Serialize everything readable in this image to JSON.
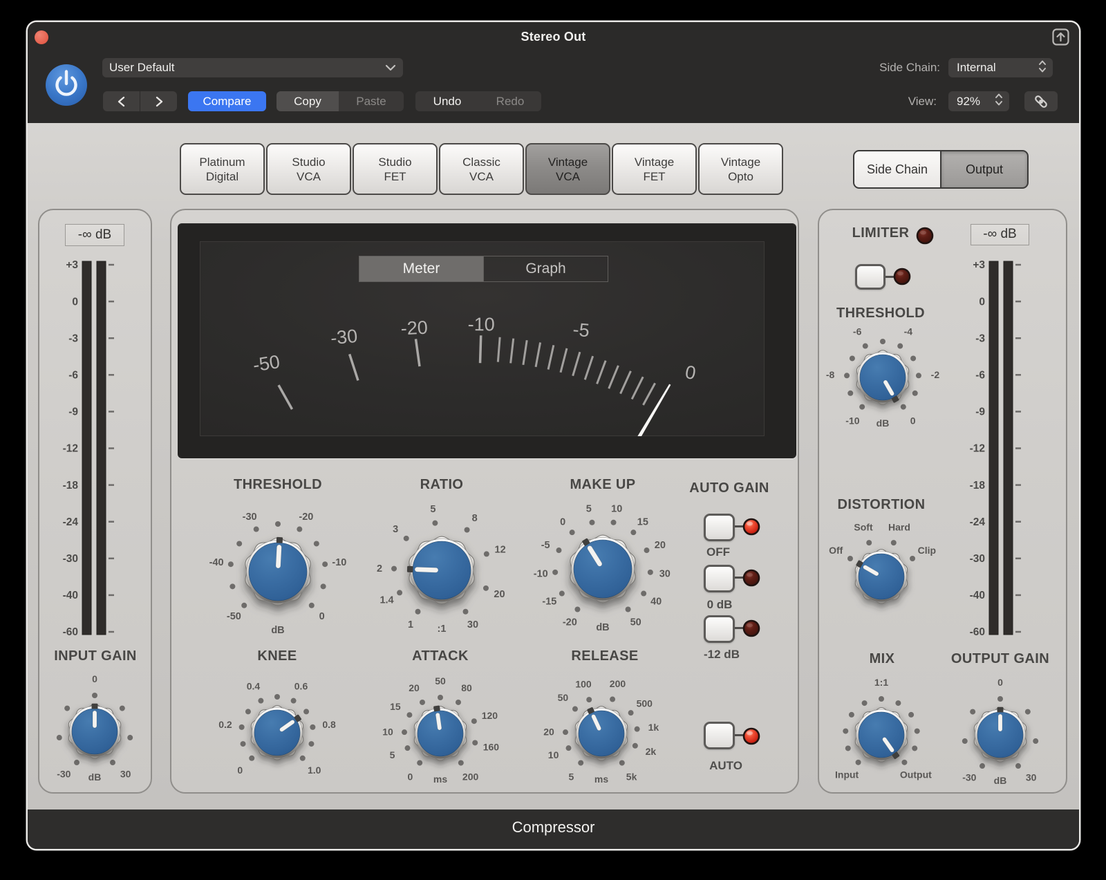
{
  "titlebar": {
    "title": "Stereo Out",
    "preset": {
      "value": "User Default"
    },
    "compare_label": "Compare",
    "copy_label": "Copy",
    "paste_label": "Paste",
    "undo_label": "Undo",
    "redo_label": "Redo",
    "side_chain_label": "Side Chain:",
    "side_chain_value": "Internal",
    "view_label": "View:",
    "view_value": "92%"
  },
  "footer": {
    "title": "Compressor"
  },
  "tabs": {
    "selected": "Vintage VCA",
    "items": [
      {
        "lines": [
          "Platinum",
          "Digital"
        ],
        "selected": false
      },
      {
        "lines": [
          "Studio",
          "VCA"
        ],
        "selected": false
      },
      {
        "lines": [
          "Studio",
          "FET"
        ],
        "selected": false
      },
      {
        "lines": [
          "Classic",
          "VCA"
        ],
        "selected": false
      },
      {
        "lines": [
          "Vintage",
          "VCA"
        ],
        "selected": true
      },
      {
        "lines": [
          "Vintage",
          "FET"
        ],
        "selected": false
      },
      {
        "lines": [
          "Vintage",
          "Opto"
        ],
        "selected": false
      }
    ]
  },
  "view_toggle": {
    "items": [
      {
        "label": "Side Chain",
        "selected": false
      },
      {
        "label": "Output",
        "selected": true
      }
    ]
  },
  "vu": {
    "buttons": [
      {
        "label": "Meter",
        "selected": true
      },
      {
        "label": "Graph",
        "selected": false
      }
    ],
    "pivot": [
      390,
      700
    ],
    "major_ticks": [
      -29.3,
      -17.9,
      -7.9,
      1.7
    ],
    "minor_ticks": {
      "from": 4.5,
      "step": 2,
      "count": 13
    },
    "labels": [
      {
        "text": "-50",
        "angle": -29.3,
        "r": 600
      },
      {
        "text": "-30",
        "angle": -17.9,
        "r": 590
      },
      {
        "text": "-20",
        "angle": -7.9,
        "r": 580
      },
      {
        "text": "-10",
        "angle": 1.7,
        "r": 580
      },
      {
        "text": "-5",
        "angle": 15.8,
        "r": 594
      },
      {
        "text": "0",
        "angle": 32.1,
        "r": 602
      }
    ],
    "needle_angle": 30.5
  },
  "input_meter": {
    "readout": "-∞ dB",
    "scale": [
      "+3",
      "0",
      "-3",
      "-6",
      "-9",
      "-12",
      "-18",
      "-24",
      "-30",
      "-40",
      "-60"
    ]
  },
  "output_meter": {
    "readout": "-∞ dB",
    "scale": [
      "+3",
      "0",
      "-3",
      "-6",
      "-9",
      "-12",
      "-18",
      "-24",
      "-30",
      "-40",
      "-60"
    ]
  },
  "auto_gain": {
    "title": "AUTO GAIN",
    "buttons": [
      {
        "label": "OFF",
        "led": true
      },
      {
        "label": "0 dB",
        "led": false
      },
      {
        "label": "-12 dB",
        "led": false
      }
    ]
  },
  "auto": {
    "label": "AUTO",
    "led": true
  },
  "limiter": {
    "title": "LIMITER",
    "led": false,
    "button_led": false
  },
  "knobs": {
    "threshold": {
      "title": "THRESHOLD",
      "size": "big",
      "pointer": 3,
      "sub": "dB",
      "labels": [
        {
          "t": "-50",
          "a": -135
        },
        {
          "t": "-40",
          "a": -81
        },
        {
          "t": "-30",
          "a": -27
        },
        {
          "t": "-20",
          "a": 27
        },
        {
          "t": "-10",
          "a": 81
        },
        {
          "t": "0",
          "a": 135
        }
      ],
      "dots": [
        -135,
        -108,
        -81,
        -54,
        -27,
        0,
        27,
        54,
        81,
        108,
        135
      ]
    },
    "ratio": {
      "title": "RATIO",
      "size": "big",
      "pointer": -88,
      "sub": ":1",
      "labels": [
        {
          "t": "1",
          "a": -150
        },
        {
          "t": "1.4",
          "a": -118
        },
        {
          "t": "2",
          "a": -88
        },
        {
          "t": "3",
          "a": -48
        },
        {
          "t": "5",
          "a": -8
        },
        {
          "t": "8",
          "a": 32
        },
        {
          "t": "12",
          "a": 70
        },
        {
          "t": "20",
          "a": 112
        },
        {
          "t": "30",
          "a": 150
        }
      ],
      "dots": [
        -150,
        -118,
        -88,
        -48,
        -8,
        32,
        70,
        112,
        150
      ]
    },
    "makeup": {
      "title": "MAKE UP",
      "size": "big",
      "pointer": -32,
      "sub": "dB",
      "labels": [
        {
          "t": "-20",
          "a": -148
        },
        {
          "t": "-15",
          "a": -121
        },
        {
          "t": "-10",
          "a": -94
        },
        {
          "t": "-5",
          "a": -67
        },
        {
          "t": "0",
          "a": -40
        },
        {
          "t": "5",
          "a": -13
        },
        {
          "t": "10",
          "a": 13
        },
        {
          "t": "15",
          "a": 40
        },
        {
          "t": "20",
          "a": 67
        },
        {
          "t": "30",
          "a": 94
        },
        {
          "t": "40",
          "a": 121
        },
        {
          "t": "50",
          "a": 148
        }
      ],
      "dots": [
        -148,
        -121,
        -94,
        -67,
        -40,
        -13,
        13,
        40,
        67,
        94,
        121,
        148
      ]
    },
    "knee": {
      "title": "KNEE",
      "size": "small",
      "pointer": 55,
      "sub": "",
      "labels": [
        {
          "t": "0",
          "a": -135
        },
        {
          "t": "0.2",
          "a": -81
        },
        {
          "t": "0.4",
          "a": -27
        },
        {
          "t": "0.6",
          "a": 27
        },
        {
          "t": "0.8",
          "a": 81
        },
        {
          "t": "1.0",
          "a": 135
        }
      ],
      "dots": [
        -135,
        -108,
        -81,
        -54,
        -27,
        0,
        27,
        54,
        81,
        108,
        135
      ]
    },
    "attack": {
      "title": "ATTACK",
      "size": "small",
      "pointer": -8,
      "sub": "ms",
      "labels": [
        {
          "t": "0",
          "a": -145
        },
        {
          "t": "5",
          "a": -114
        },
        {
          "t": "10",
          "a": -88
        },
        {
          "t": "15",
          "a": -59
        },
        {
          "t": "20",
          "a": -30
        },
        {
          "t": "50",
          "a": 0
        },
        {
          "t": "80",
          "a": 30
        },
        {
          "t": "120",
          "a": 70
        },
        {
          "t": "160",
          "a": 105
        },
        {
          "t": "200",
          "a": 145
        }
      ],
      "dots": [
        -145,
        -114,
        -88,
        -59,
        -30,
        0,
        30,
        70,
        105,
        145
      ]
    },
    "release": {
      "title": "RELEASE",
      "size": "small",
      "pointer": -25,
      "sub": "ms",
      "labels": [
        {
          "t": "100",
          "a": -20
        },
        {
          "t": "50",
          "a": -47
        },
        {
          "t": "20",
          "a": -88
        },
        {
          "t": "10",
          "a": -114
        },
        {
          "t": "5",
          "a": -145
        },
        {
          "t": "200",
          "a": 18
        },
        {
          "t": "500",
          "a": 55
        },
        {
          "t": "1k",
          "a": 83
        },
        {
          "t": "2k",
          "a": 110
        },
        {
          "t": "5k",
          "a": 145
        }
      ],
      "dots": [
        -145,
        -114,
        -88,
        -47,
        -20,
        18,
        55,
        83,
        110,
        145
      ]
    },
    "input_gain": {
      "title": "INPUT GAIN",
      "size": "small",
      "pointer": 0,
      "sub": "dB",
      "labels": [
        {
          "t": "0",
          "a": 0
        },
        {
          "t": "-30",
          "a": -144
        },
        {
          "t": "30",
          "a": 144
        }
      ],
      "dots": [
        -150,
        -100,
        -50,
        0,
        50,
        100,
        150
      ]
    },
    "limiter_threshold": {
      "title": "THRESHOLD",
      "size": "small",
      "pointer": 150,
      "sub": "dB",
      "labels": [
        {
          "t": "-10",
          "a": -145
        },
        {
          "t": "-8",
          "a": -87
        },
        {
          "t": "-6",
          "a": -29
        },
        {
          "t": "-4",
          "a": 29
        },
        {
          "t": "-2",
          "a": 87
        },
        {
          "t": "0",
          "a": 145
        }
      ],
      "dots": [
        -145,
        -116,
        -87,
        -58,
        -29,
        0,
        29,
        58,
        87,
        116,
        145
      ]
    },
    "distortion": {
      "title": "DISTORTION",
      "size": "small",
      "pointer": -60,
      "sub": "",
      "labels": [
        {
          "t": "Off",
          "a": -60
        },
        {
          "t": "Soft",
          "a": -20
        },
        {
          "t": "Hard",
          "a": 20
        },
        {
          "t": "Clip",
          "a": 60
        }
      ],
      "dots": [
        -60,
        -20,
        20,
        60
      ]
    },
    "mix": {
      "title": "MIX",
      "size": "small",
      "pointer": 145,
      "sub": "",
      "labels": [
        {
          "t": "1:1",
          "a": 0
        },
        {
          "t": "Input",
          "a": -139
        },
        {
          "t": "Output",
          "a": 139
        }
      ],
      "dots": [
        -140,
        -112,
        -84,
        -56,
        -28,
        0,
        28,
        56,
        84,
        112,
        140
      ]
    },
    "output_gain": {
      "title": "OUTPUT GAIN",
      "size": "small",
      "pointer": 0,
      "sub": "dB",
      "labels": [
        {
          "t": "0",
          "a": 0
        },
        {
          "t": "-30",
          "a": -144
        },
        {
          "t": "30",
          "a": 144
        }
      ],
      "dots": [
        -150,
        -100,
        -50,
        0,
        50,
        100,
        150
      ]
    }
  }
}
